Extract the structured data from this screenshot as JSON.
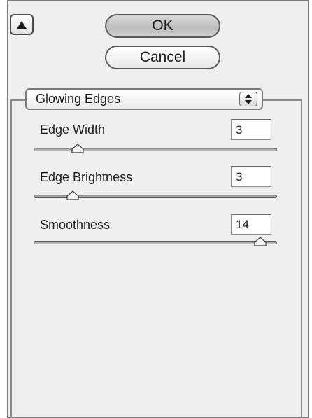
{
  "dialog": {
    "ok_label": "OK",
    "cancel_label": "Cancel",
    "collapse_icon": "triangle-up-icon"
  },
  "filter": {
    "selected": "Glowing Edges",
    "stepper_icon": "up-down-arrows-icon"
  },
  "settings": [
    {
      "label": "Edge Width",
      "value": "3",
      "slider_fraction": 0.18
    },
    {
      "label": "Edge Brightness",
      "value": "3",
      "slider_fraction": 0.16
    },
    {
      "label": "Smoothness",
      "value": "14",
      "slider_fraction": 0.93
    }
  ]
}
